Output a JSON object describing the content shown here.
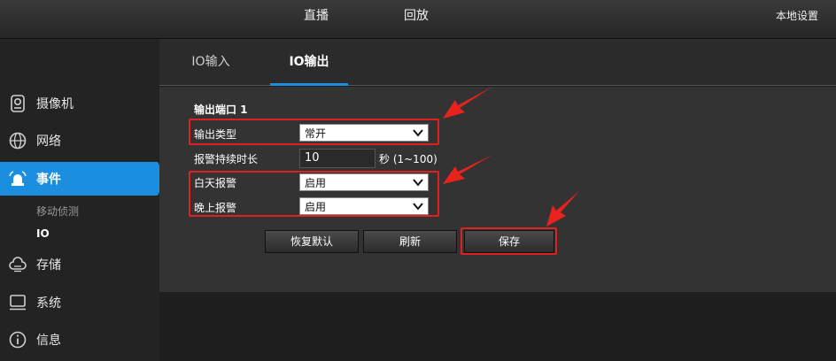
{
  "topbar": {
    "live": "直播",
    "playback": "回放",
    "local_settings": "本地设置"
  },
  "sidebar": {
    "items": [
      {
        "label": "摄像机",
        "icon": "camera-icon"
      },
      {
        "label": "网络",
        "icon": "network-globe-icon"
      },
      {
        "label": "事件",
        "icon": "alarm-icon"
      },
      {
        "label": "存储",
        "icon": "cloud-storage-icon"
      },
      {
        "label": "系统",
        "icon": "monitor-icon"
      },
      {
        "label": "信息",
        "icon": "info-icon"
      }
    ],
    "sub_items": [
      {
        "label": "移动侦测"
      },
      {
        "label": "IO"
      }
    ],
    "active_item": "事件",
    "active_sub_item": "IO"
  },
  "tabs": [
    {
      "label": "IO输入"
    },
    {
      "label": "IO输出"
    }
  ],
  "form": {
    "section_title": "输出端口 1",
    "output_type_label": "输出类型",
    "output_type_value": "常开",
    "duration_label": "报警持续时长",
    "duration_value": "10",
    "duration_unit": "秒 (1~100)",
    "day_alarm_label": "白天报警",
    "day_alarm_value": "启用",
    "night_alarm_label": "晚上报警",
    "night_alarm_value": "启用"
  },
  "buttons": {
    "restore": "恢复默认",
    "refresh": "刷新",
    "save": "保存"
  },
  "colors": {
    "accent": "#1b8ee0",
    "highlight": "#e02020",
    "panel": "#333333"
  }
}
